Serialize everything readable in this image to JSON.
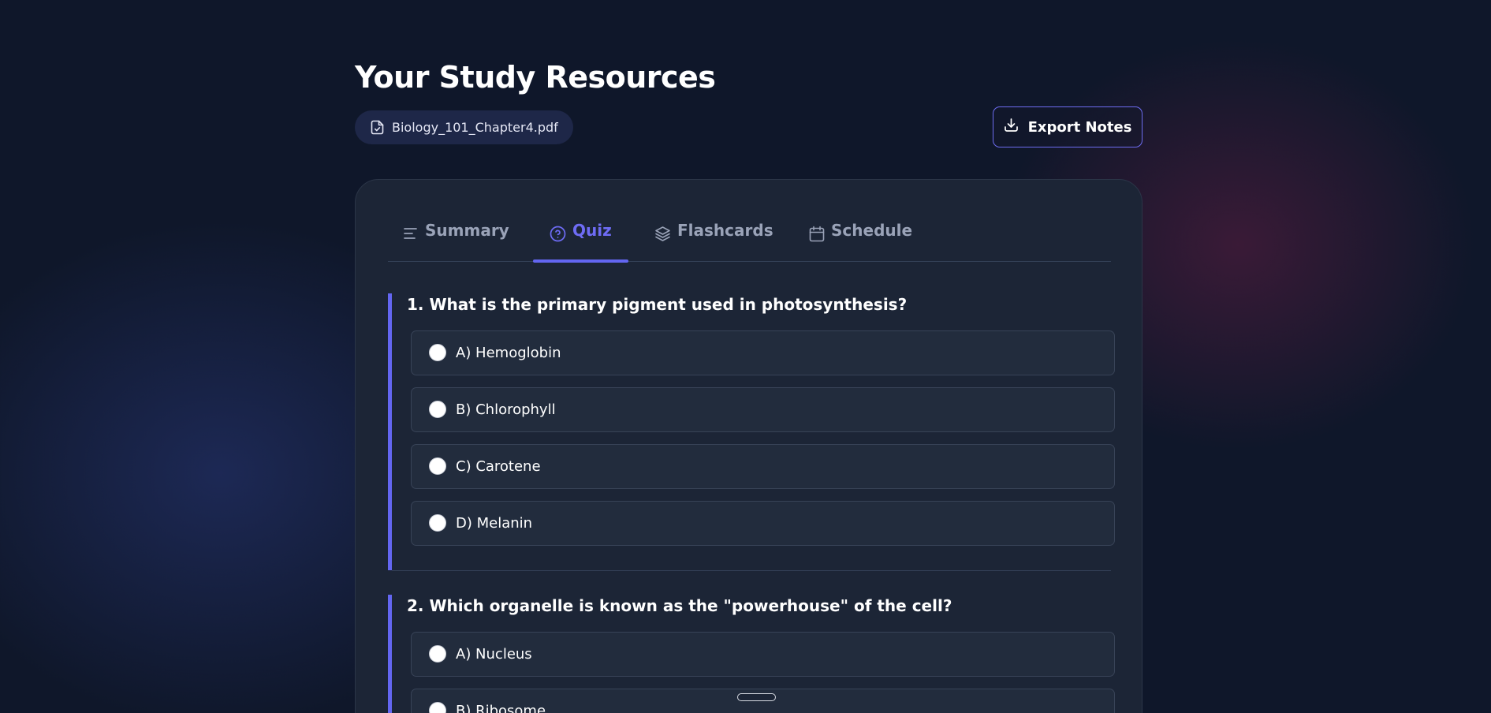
{
  "header": {
    "title": "Your Study Resources",
    "file_name": "Biology_101_Chapter4.pdf",
    "file_icon": "file-check-icon",
    "export_label": "Export Notes",
    "export_icon": "download-icon"
  },
  "tabs": [
    {
      "label": "Summary",
      "icon": "align-left-icon",
      "active": false
    },
    {
      "label": "Quiz",
      "icon": "help-circle-icon",
      "active": true
    },
    {
      "label": "Flashcards",
      "icon": "layers-icon",
      "active": false
    },
    {
      "label": "Schedule",
      "icon": "calendar-icon",
      "active": false
    }
  ],
  "quiz": {
    "questions": [
      {
        "text": "1. What is the primary pigment used in photosynthesis?",
        "options": [
          "A) Hemoglobin",
          "B) Chlorophyll",
          "C) Carotene",
          "D) Melanin"
        ]
      },
      {
        "text": "2. Which organelle is known as the \"powerhouse\" of the cell?",
        "options": [
          "A) Nucleus",
          "B) Ribosome"
        ]
      }
    ]
  },
  "colors": {
    "accent": "#6366f1",
    "background": "#0f172a",
    "card": "#1c2536",
    "option_background": "#222c3d",
    "muted_text": "#9aa3b8"
  }
}
